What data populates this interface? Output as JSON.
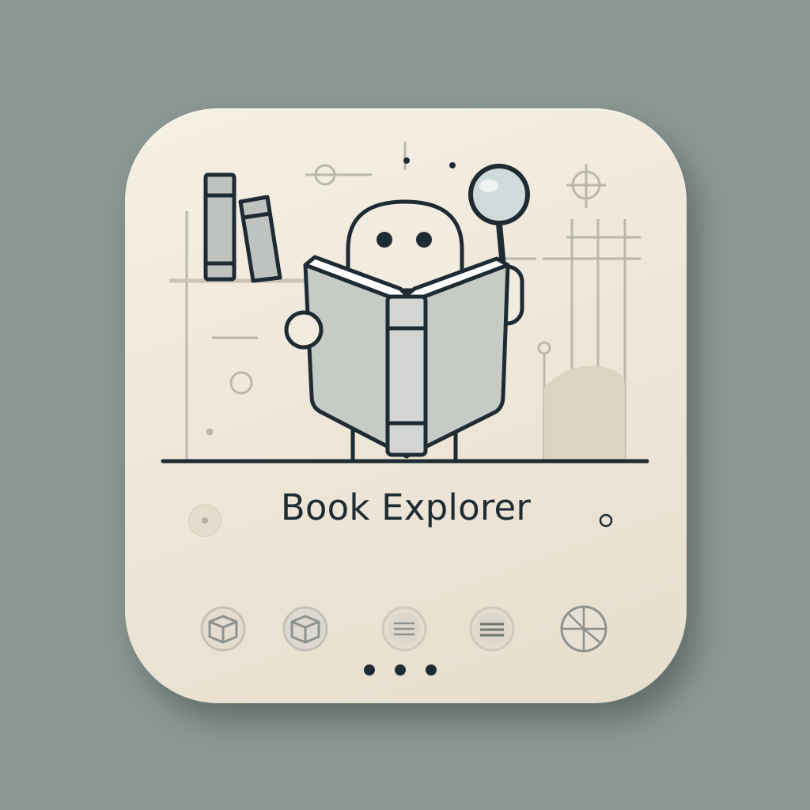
{
  "app": {
    "name": "Book Explorer"
  },
  "icons": {
    "background_shapes": "decorative-geometry-icon",
    "bookshelf": "bookshelf-icon",
    "mascot": "robot-reader-icon",
    "magnifier": "magnifying-glass-icon",
    "row": [
      "cube-icon",
      "cube-icon",
      "list-icon",
      "list-icon",
      "pie-chart-icon"
    ],
    "more": "more-dots-icon"
  },
  "colors": {
    "background": "#8c9893",
    "card": "#f2ebdf",
    "ink": "#1f2b33",
    "book": "#c7cbc6",
    "lens": "#cfdadb",
    "muted": "#b0aca3"
  }
}
